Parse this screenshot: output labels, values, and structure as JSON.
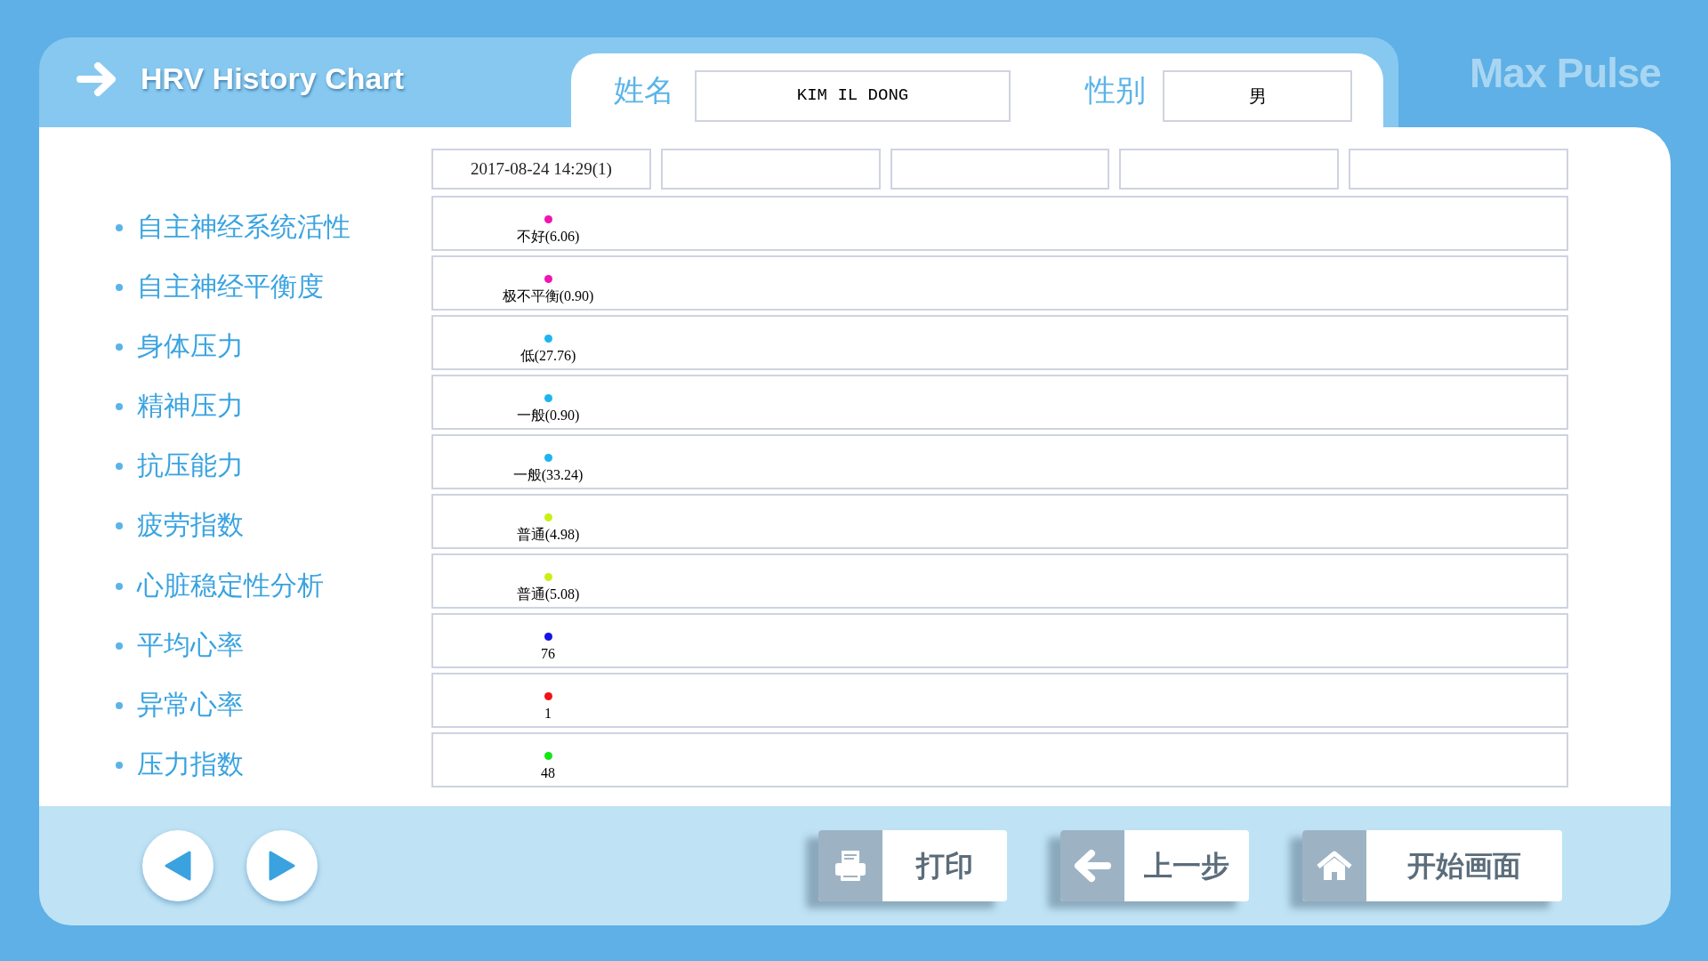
{
  "header": {
    "title": "HRV History Chart",
    "brand": "Max Pulse"
  },
  "patient": {
    "name_label": "姓名",
    "name": "KIM IL DONG",
    "gender_label": "性别",
    "gender": "男"
  },
  "date_columns": [
    "2017-08-24 14:29(1)"
  ],
  "rows": [
    {
      "label": "自主神经系统活性",
      "value": "不好(6.06)",
      "color": "#f014b4"
    },
    {
      "label": "自主神经平衡度",
      "value": "极不平衡(0.90)",
      "color": "#f014b4"
    },
    {
      "label": "身体压力",
      "value": "低(27.76)",
      "color": "#1eb4f0"
    },
    {
      "label": "精神压力",
      "value": "一般(0.90)",
      "color": "#1eb4f0"
    },
    {
      "label": "抗压能力",
      "value": "一般(33.24)",
      "color": "#1eb4f0"
    },
    {
      "label": "疲劳指数",
      "value": "普通(4.98)",
      "color": "#c8f014"
    },
    {
      "label": "心脏稳定性分析",
      "value": "普通(5.08)",
      "color": "#c8f014"
    },
    {
      "label": "平均心率",
      "value": "76",
      "color": "#1414e6"
    },
    {
      "label": "异常心率",
      "value": "1",
      "color": "#f01414"
    },
    {
      "label": "压力指数",
      "value": "48",
      "color": "#14e614"
    }
  ],
  "buttons": [
    {
      "kind": "print",
      "label": "打印"
    },
    {
      "kind": "back",
      "label": "上一步"
    },
    {
      "kind": "home",
      "label": "开始画面"
    }
  ]
}
